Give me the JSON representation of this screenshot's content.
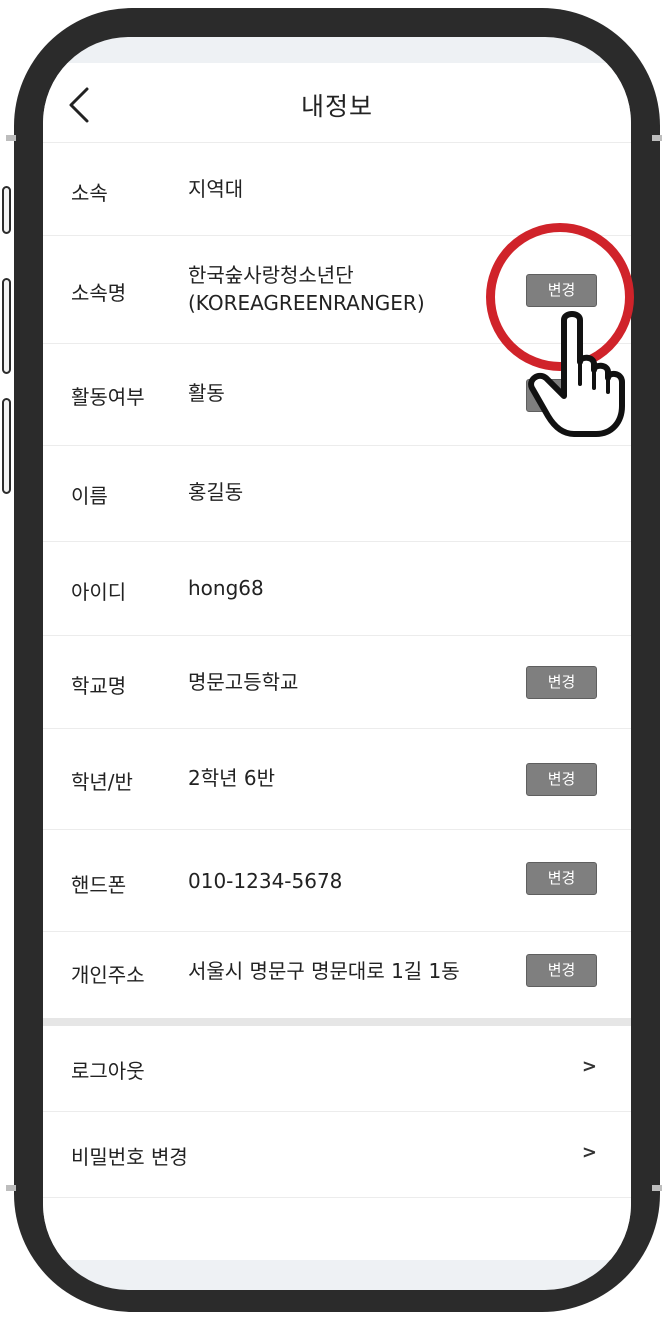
{
  "header": {
    "title": "내정보"
  },
  "rows": [
    {
      "label": "소속",
      "value": [
        "지역대"
      ]
    },
    {
      "label": "소속명",
      "value": [
        "한국숲사랑청소년단",
        "(KOREAGREENRANGER)"
      ],
      "button": "변경"
    },
    {
      "label": "활동여부",
      "value": [
        "활동"
      ],
      "button": "변경"
    },
    {
      "label": "이름",
      "value": [
        "홍길동"
      ]
    },
    {
      "label": "아이디",
      "value": [
        "hong68"
      ]
    },
    {
      "label": "학교명",
      "value": [
        "명문고등학교"
      ],
      "button": "변경"
    },
    {
      "label": "학년/반",
      "value": [
        "2학년 6반"
      ],
      "button": "변경"
    },
    {
      "label": "핸드폰",
      "value": [
        "010-1234-5678"
      ],
      "button": "변경"
    },
    {
      "label": "개인주소",
      "value": [
        "서울시 명문구 명문대로 1길 1동"
      ],
      "button": "변경"
    }
  ],
  "menu": [
    {
      "label": "로그아웃",
      "chevron": ">"
    },
    {
      "label": "비밀번호 변경",
      "chevron": ">"
    }
  ],
  "colors": {
    "frame": "#2b2b2b",
    "button_bg": "#7f7f7f",
    "highlight": "#d0232a"
  },
  "icons": {
    "back": "chevron-left-icon",
    "pointer": "hand-pointer-icon"
  }
}
